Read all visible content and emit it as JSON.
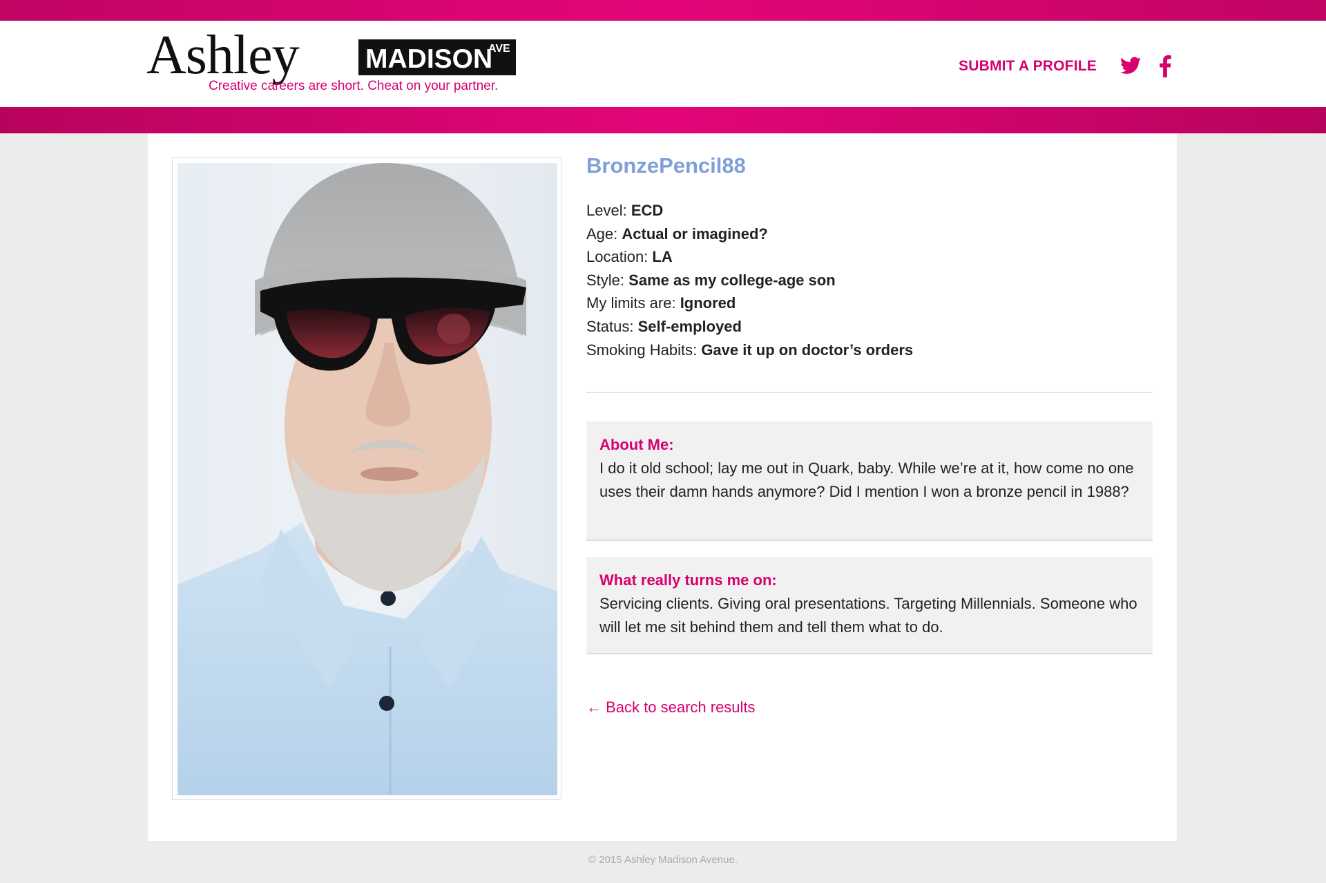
{
  "header": {
    "logo_ashley": "Ashley",
    "logo_madison": "MADISON",
    "logo_ave": "AVE",
    "tagline": "Creative careers are short. Cheat on your partner.",
    "nav_submit": "SUBMIT A PROFILE",
    "social_icons": [
      "twitter-icon",
      "facebook-icon"
    ]
  },
  "profile": {
    "name": "BronzePencil88",
    "details": [
      {
        "label": "Level:",
        "value": "ECD"
      },
      {
        "label": "Age:",
        "value": "Actual or imagined?"
      },
      {
        "label": "Location:",
        "value": "LA"
      },
      {
        "label": "Style:",
        "value": "Same as my college-age son"
      },
      {
        "label": "My limits are:",
        "value": "Ignored"
      },
      {
        "label": "Status:",
        "value": "Self-employed"
      },
      {
        "label": "Smoking Habits:",
        "value": "Gave it up on doctor’s orders"
      }
    ],
    "about": {
      "title": "About Me:",
      "body": "I do it old school; lay me out in Quark, baby. While we’re at it, how come no one uses their damn hands anymore? Did I mention I won a bronze pencil in 1988?"
    },
    "turns_on": {
      "title": "What really turns me on:",
      "body": "Servicing clients. Giving oral presentations. Targeting Millennials. Someone who will let me sit behind them and tell them what to do."
    },
    "back_link": "← Back to search results"
  },
  "footer": {
    "copyright": "© 2015 Ashley Madison Avenue."
  },
  "colors": {
    "brand_pink": "#d6006f",
    "name_blue": "#7f9fd8",
    "background": "#ececec",
    "panel": "#f1f1f1"
  }
}
